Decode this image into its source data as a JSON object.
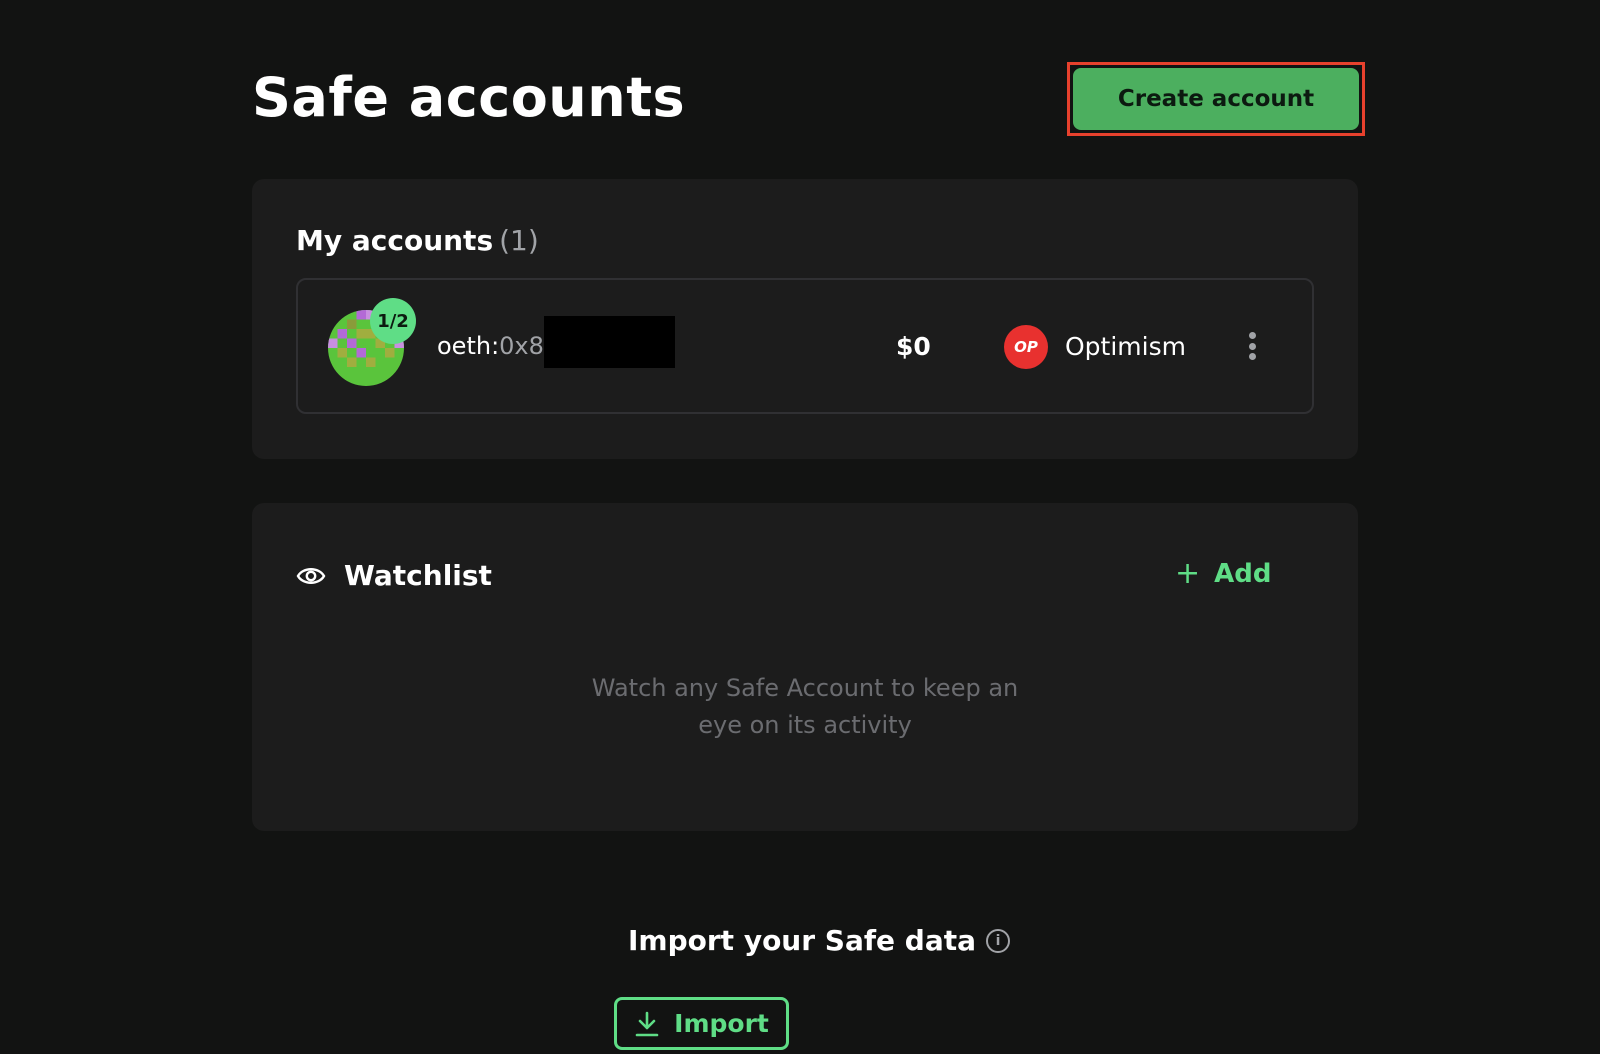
{
  "header": {
    "title": "Safe accounts",
    "create_button_label": "Create account"
  },
  "my_accounts": {
    "title": "My accounts",
    "count": "(1)",
    "items": [
      {
        "threshold": "1/2",
        "address_prefix": "oeth:",
        "address_visible": "0x8",
        "balance": "$0",
        "chain_logo_text": "OP",
        "chain_name": "Optimism",
        "chain_color": "#e8312f"
      }
    ]
  },
  "watchlist": {
    "title": "Watchlist",
    "add_label": "Add",
    "add_icon": "+",
    "empty_line1": "Watch any Safe Account to keep an",
    "empty_line2": "eye on its activity"
  },
  "import": {
    "title": "Import your Safe data",
    "info_icon": "i",
    "button_label": "Import"
  },
  "colors": {
    "background": "#121312",
    "panel": "#1c1c1c",
    "accent_green": "#5fdd86",
    "button_green": "#4caf5f",
    "highlight_red": "#e8412d"
  }
}
